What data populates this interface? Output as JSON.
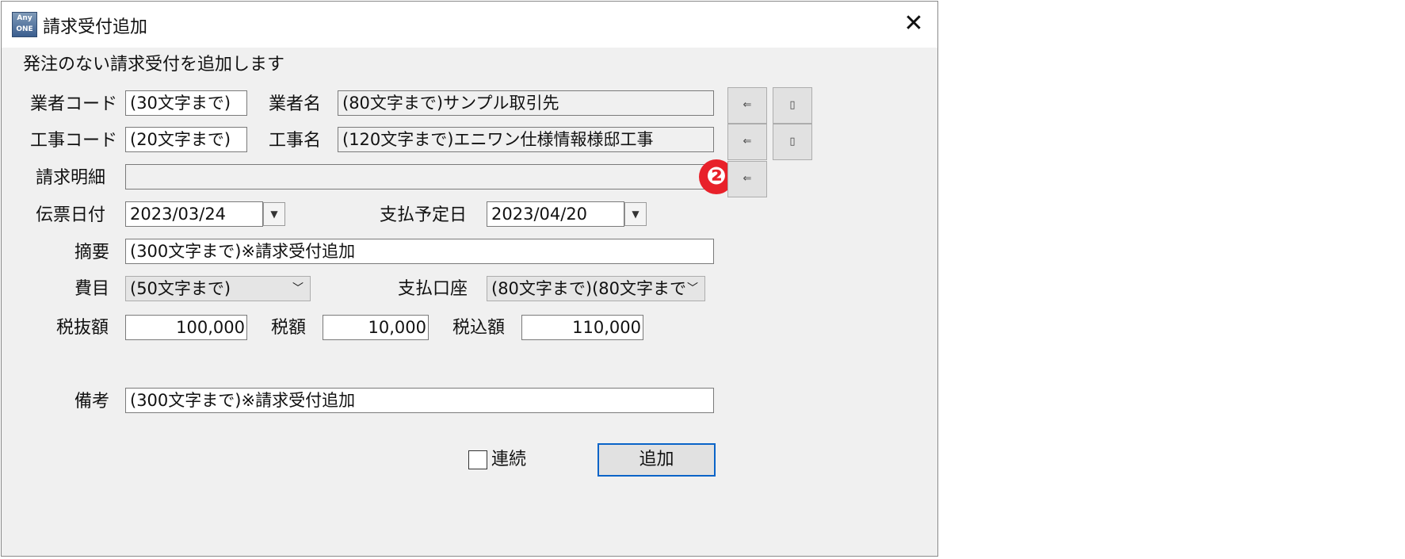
{
  "window": {
    "title": "請求受付追加",
    "app_icon_top": "Any",
    "app_icon_bottom": "ONE",
    "close_glyph": "✕"
  },
  "form": {
    "description": "発注のない請求受付を追加します",
    "vendor_code": {
      "label": "業者コード",
      "value": "(30文字まで)"
    },
    "vendor_name": {
      "label": "業者名",
      "value": "(80文字まで)サンプル取引先"
    },
    "project_code": {
      "label": "工事コード",
      "value": "(20文字まで)"
    },
    "project_name": {
      "label": "工事名",
      "value": "(120文字まで)エニワン仕様情報様邸工事"
    },
    "invoice_detail": {
      "label": "請求明細",
      "value": ""
    },
    "slip_date": {
      "label": "伝票日付",
      "value": "2023/03/24"
    },
    "payment_date": {
      "label": "支払予定日",
      "value": "2023/04/20"
    },
    "summary": {
      "label": "摘要",
      "value": "(300文字まで)※請求受付追加"
    },
    "expense_item": {
      "label": "費目",
      "value": "(50文字まで)"
    },
    "payment_account": {
      "label": "支払口座",
      "value": "(80文字まで)(80文字まで"
    },
    "amount_excl_tax": {
      "label": "税抜額",
      "value": "100,000"
    },
    "tax_amount": {
      "label": "税額",
      "value": "10,000"
    },
    "amount_incl_tax": {
      "label": "税込額",
      "value": "110,000"
    },
    "remarks": {
      "label": "備考",
      "value": "(300文字まで)※請求受付追加"
    },
    "continuous": {
      "label": "連続",
      "checked": false
    },
    "add_button": "追加"
  },
  "annotation": {
    "step_badge": "❷",
    "color": "#e8212a"
  },
  "icons": {
    "select": "select-icon",
    "clear": "clear-icon",
    "calendar": "calendar-dropdown-icon",
    "chevron": "chevron-down-icon"
  },
  "glyphs": {
    "select": "⇐",
    "clear": "▯",
    "calendar": "▼",
    "chevron": "﹀"
  }
}
